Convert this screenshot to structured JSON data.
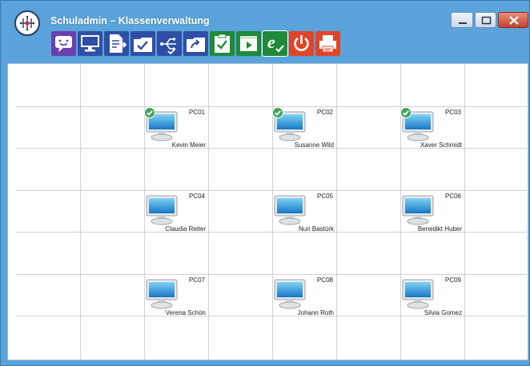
{
  "window": {
    "title": "Schuladmin – Klassenverwaltung"
  },
  "toolbar": {
    "items": [
      {
        "name": "message-button",
        "icon": "chat-bubble-icon",
        "color": "#6a3fb0"
      },
      {
        "name": "screen-button",
        "icon": "monitor-icon",
        "color": "#2f4fa6"
      },
      {
        "name": "document-button",
        "icon": "document-arrow-icon",
        "color": "#2f4fa6"
      },
      {
        "name": "collect-button",
        "icon": "folder-check-icon",
        "color": "#2f4fa6"
      },
      {
        "name": "usb-button",
        "icon": "usb-check-icon",
        "color": "#2f4fa6"
      },
      {
        "name": "share-button",
        "icon": "folder-share-icon",
        "color": "#2f4fa6"
      },
      {
        "name": "test-button",
        "icon": "clipboard-check-icon",
        "color": "#1f8a3a"
      },
      {
        "name": "presentation-button",
        "icon": "play-icon",
        "color": "#1f8a3a"
      },
      {
        "name": "internet-button",
        "icon": "internet-check-icon",
        "color": "#1f8a3a",
        "active": true
      },
      {
        "name": "power-button",
        "icon": "power-icon",
        "color": "#e0452a"
      },
      {
        "name": "print-button",
        "icon": "printer-icon",
        "color": "#e0452a"
      }
    ]
  },
  "pcs": [
    {
      "pc": "PC01",
      "user": "Kevin Meier",
      "checked": true
    },
    {
      "pc": "PC02",
      "user": "Susanne Wild",
      "checked": true
    },
    {
      "pc": "PC03",
      "user": "Xaver Schmidt",
      "checked": true
    },
    {
      "pc": "PC04",
      "user": "Claudia Reiter",
      "checked": false
    },
    {
      "pc": "PC05",
      "user": "Nuri Bastürk",
      "checked": false
    },
    {
      "pc": "PC06",
      "user": "Benedikt Huber",
      "checked": false
    },
    {
      "pc": "PC07",
      "user": "Verena Schön",
      "checked": false
    },
    {
      "pc": "PC08",
      "user": "Johann Roth",
      "checked": false
    },
    {
      "pc": "PC09",
      "user": "Silvia Gomez",
      "checked": false
    }
  ],
  "colors": {
    "titlebar": "#5aa3db",
    "grid_line": "#cdd1d6",
    "check": "#3fa65a"
  }
}
